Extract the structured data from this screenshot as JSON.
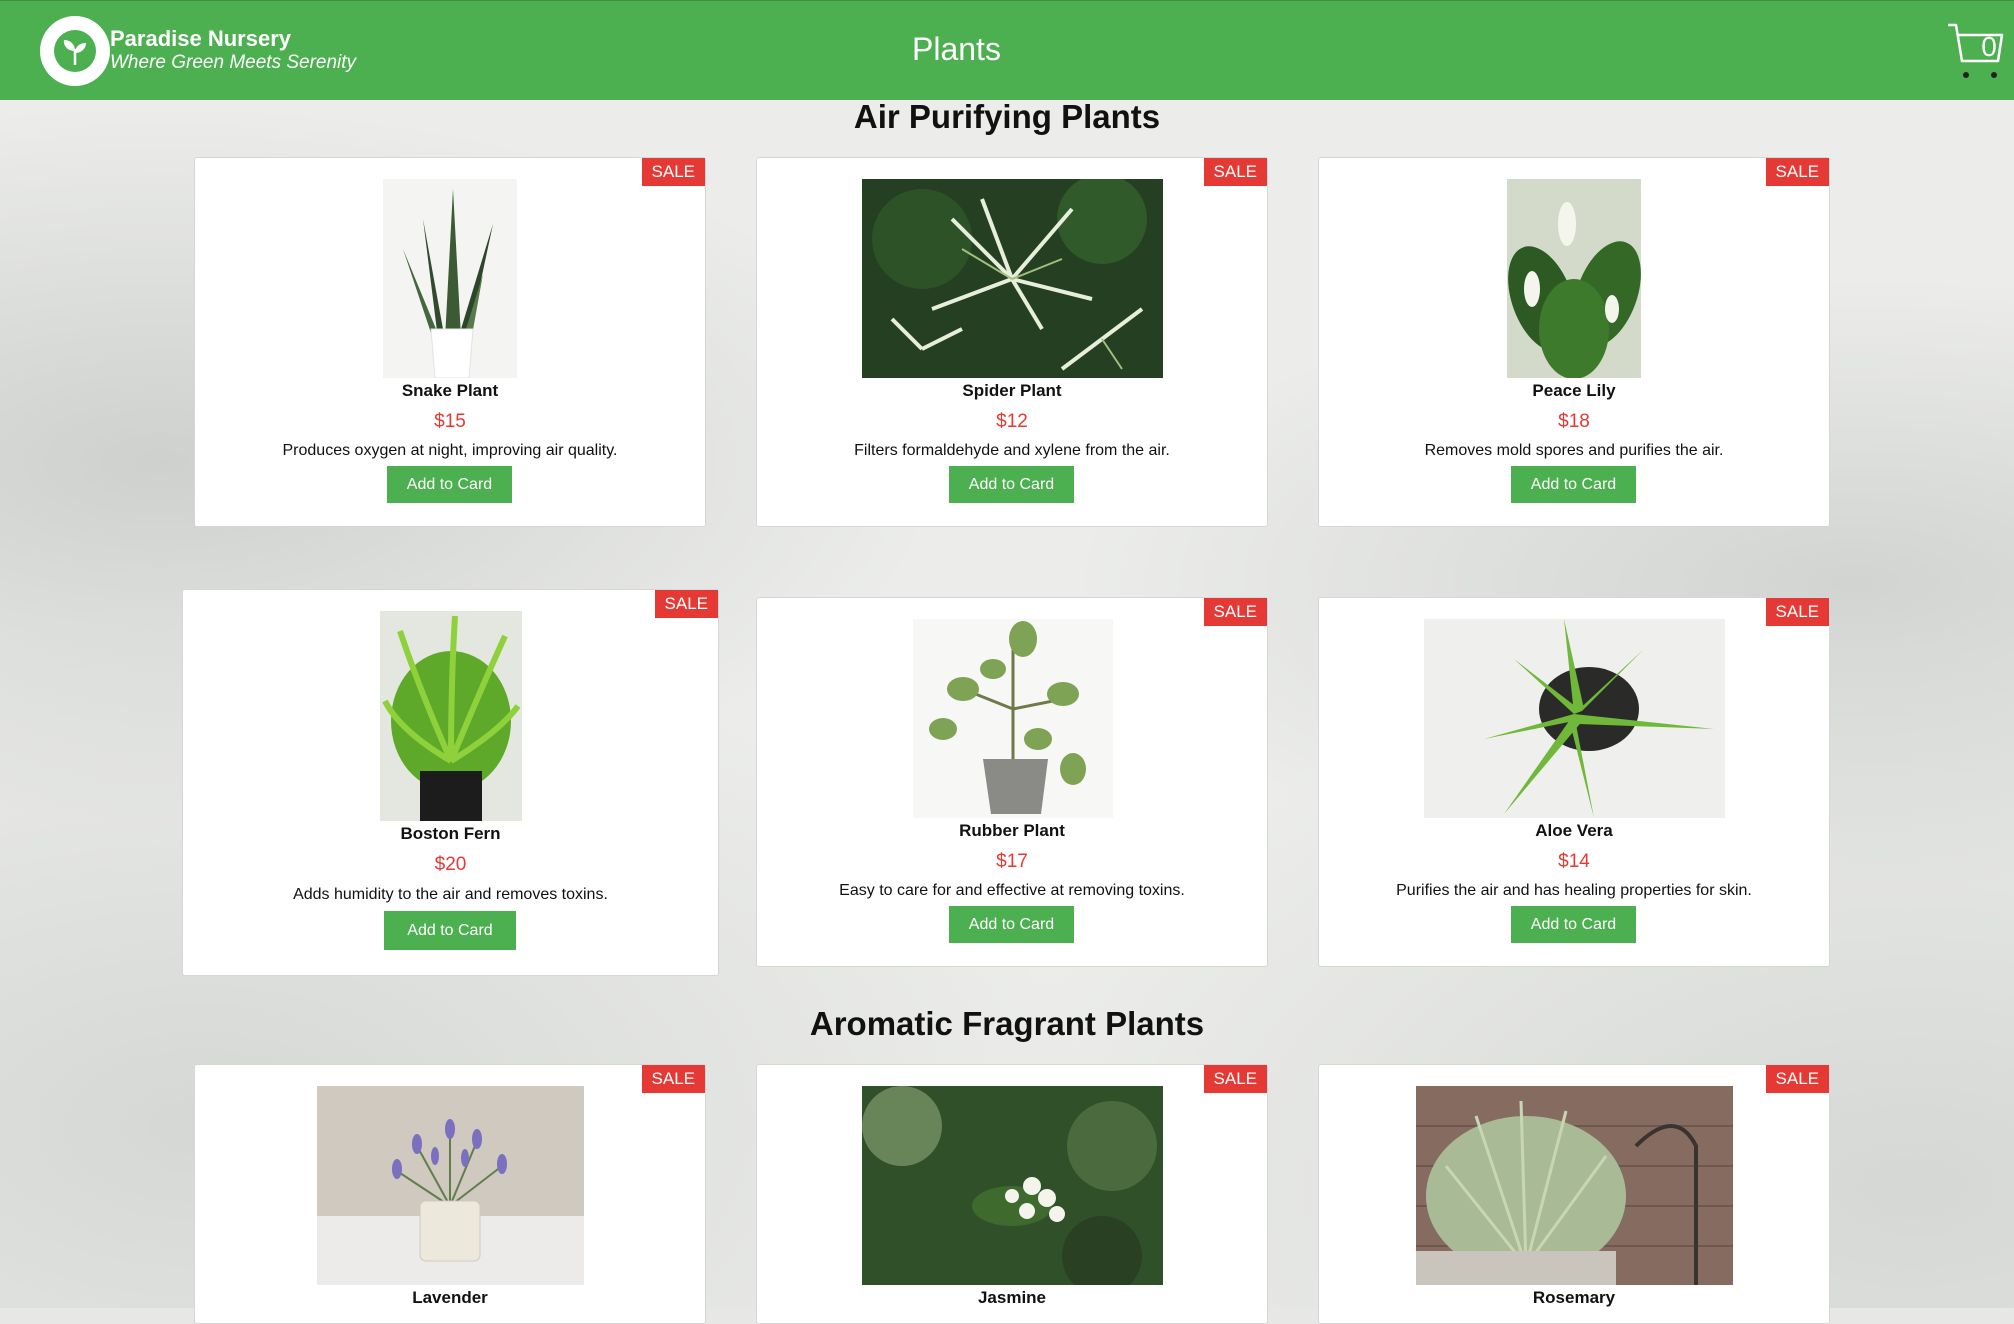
{
  "header": {
    "brand_name": "Paradise Nursery",
    "brand_tagline": "Where Green Meets Serenity",
    "title": "Plants",
    "cart_count": "0"
  },
  "colors": {
    "accent": "#4caf50",
    "sale": "#e53935",
    "price": "#e53935"
  },
  "sections": [
    {
      "title": "Air Purifying Plants",
      "plants": [
        {
          "name": "Snake Plant",
          "price": "$15",
          "description": "Produces oxygen at night, improving air quality.",
          "button": "Add to Card",
          "badge": "SALE"
        },
        {
          "name": "Spider Plant",
          "price": "$12",
          "description": "Filters formaldehyde and xylene from the air.",
          "button": "Add to Card",
          "badge": "SALE"
        },
        {
          "name": "Peace Lily",
          "price": "$18",
          "description": "Removes mold spores and purifies the air.",
          "button": "Add to Card",
          "badge": "SALE"
        },
        {
          "name": "Boston Fern",
          "price": "$20",
          "description": "Adds humidity to the air and removes toxins.",
          "button": "Add to Card",
          "badge": "SALE"
        },
        {
          "name": "Rubber Plant",
          "price": "$17",
          "description": "Easy to care for and effective at removing toxins.",
          "button": "Add to Card",
          "badge": "SALE"
        },
        {
          "name": "Aloe Vera",
          "price": "$14",
          "description": "Purifies the air and has healing properties for skin.",
          "button": "Add to Card",
          "badge": "SALE"
        }
      ]
    },
    {
      "title": "Aromatic Fragrant Plants",
      "plants": [
        {
          "name": "Lavender",
          "badge": "SALE"
        },
        {
          "name": "Jasmine",
          "badge": "SALE"
        },
        {
          "name": "Rosemary",
          "badge": "SALE"
        }
      ]
    }
  ]
}
